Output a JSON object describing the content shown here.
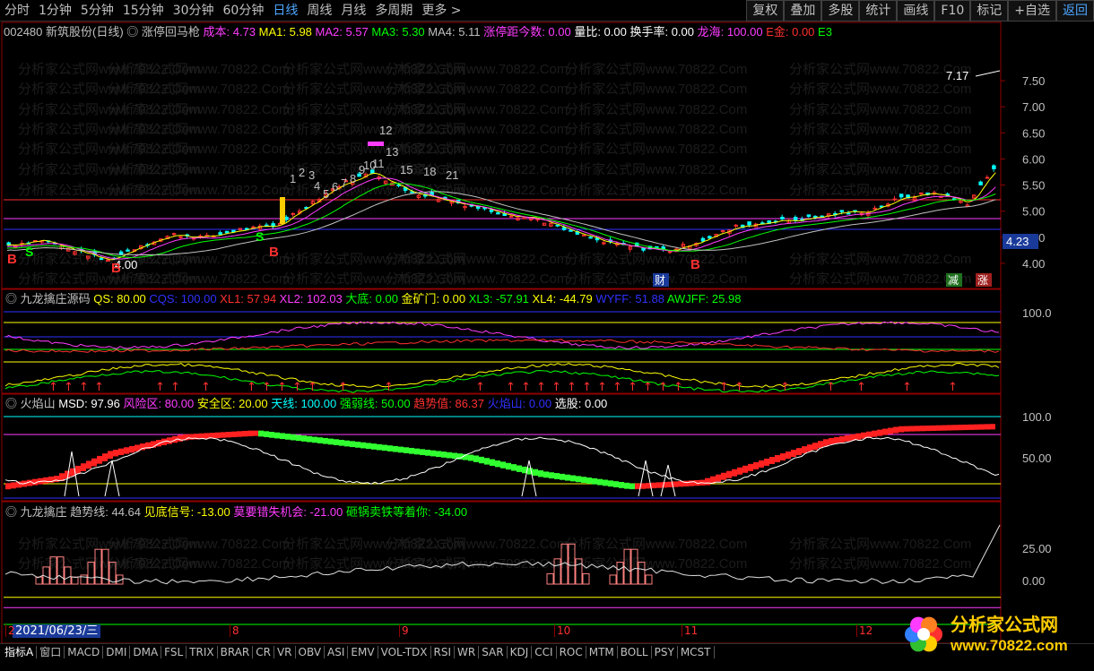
{
  "topbar": {
    "periods": [
      "分时",
      "1分钟",
      "5分钟",
      "15分钟",
      "30分钟",
      "60分钟",
      "日线",
      "周线",
      "月线",
      "多周期",
      "更多 >"
    ],
    "active": "日线",
    "tools": [
      "复权",
      "叠加",
      "多股",
      "统计",
      "画线",
      "F10",
      "标记",
      "+自选",
      "返回"
    ]
  },
  "main_panel": {
    "code": "002480",
    "name": "新筑股份(日线)",
    "formula": "涨停回马枪",
    "fields": [
      {
        "k": "成本: ",
        "v": "4.73",
        "c": "#ff3cff"
      },
      {
        "k": "MA1: ",
        "v": "5.98",
        "c": "#ffff00"
      },
      {
        "k": "MA2: ",
        "v": "5.57",
        "c": "#ff3cff"
      },
      {
        "k": "MA3: ",
        "v": "5.30",
        "c": "#00ff00"
      },
      {
        "k": "MA4: ",
        "v": "5.11",
        "c": "#c0c0c0"
      },
      {
        "k": "涨停距今数: ",
        "v": "0.00",
        "c": "#ff3cff"
      },
      {
        "k": "量比: ",
        "v": "0.00",
        "c": "#ffffff"
      },
      {
        "k": "换手率: ",
        "v": "0.00",
        "c": "#ffffff"
      },
      {
        "k": "龙海: ",
        "v": "100.00",
        "c": "#ff3cff"
      },
      {
        "k": "E金: ",
        "v": "0.00",
        "c": "#ff3030"
      },
      {
        "k": "E3",
        "v": "",
        "c": "#00ff00"
      }
    ],
    "y_ticks": [
      "7.50",
      "7.00",
      "6.50",
      "6.00",
      "5.50",
      "5.00",
      "4.50",
      "4.00"
    ],
    "price_box": "4.23",
    "high_label": "7.17",
    "low_label": "4.00",
    "b_labels": [
      "B",
      "B",
      "B",
      "B"
    ],
    "s_labels": [
      "S",
      "S"
    ],
    "counts": [
      "1",
      "2",
      "3",
      "4",
      "5",
      "6",
      "7",
      "8",
      "9",
      "10",
      "11",
      "12",
      "13",
      "15",
      "18",
      "21"
    ],
    "badges": [
      "财",
      "减",
      "涨"
    ],
    "watermark": "分析家公式网www.70822.Com"
  },
  "panel2": {
    "title": "九龙擒庄源码",
    "fields": [
      {
        "k": "QS: ",
        "v": "80.00",
        "c": "#ffff00"
      },
      {
        "k": "CQS: ",
        "v": "100.00",
        "c": "#3030ff"
      },
      {
        "k": "XL1: ",
        "v": "57.94",
        "c": "#ff3030"
      },
      {
        "k": "XL2: ",
        "v": "102.03",
        "c": "#ff3cff"
      },
      {
        "k": "大底: ",
        "v": "0.00",
        "c": "#00ff00"
      },
      {
        "k": "金矿门: ",
        "v": "0.00",
        "c": "#ffff00"
      },
      {
        "k": "XL3: ",
        "v": "-57.91",
        "c": "#00ff00"
      },
      {
        "k": "XL4: ",
        "v": "-44.79",
        "c": "#ffff00"
      },
      {
        "k": "WYFF: ",
        "v": "51.88",
        "c": "#3030ff"
      },
      {
        "k": "AWJFF: ",
        "v": "25.98",
        "c": "#00ff00"
      }
    ],
    "y_tick": "100.0"
  },
  "panel3": {
    "title": "火焰山",
    "fields": [
      {
        "k": "MSD: ",
        "v": "97.96",
        "c": "#ffffff"
      },
      {
        "k": "风险区: ",
        "v": "80.00",
        "c": "#ff3cff"
      },
      {
        "k": "安全区: ",
        "v": "20.00",
        "c": "#ffff00"
      },
      {
        "k": "天线: ",
        "v": "100.00",
        "c": "#00ffff"
      },
      {
        "k": "强弱线: ",
        "v": "50.00",
        "c": "#00ff00"
      },
      {
        "k": "趋势值: ",
        "v": "86.37",
        "c": "#ff3030"
      },
      {
        "k": "火焰山: ",
        "v": "0.00",
        "c": "#3030ff"
      },
      {
        "k": "选股: ",
        "v": "0.00",
        "c": "#ffffff"
      }
    ],
    "y_ticks": [
      "100.0",
      "50.00"
    ]
  },
  "panel4": {
    "title": "九龙擒庄",
    "fields": [
      {
        "k": "趋势线: ",
        "v": "44.64",
        "c": "#c0c0c0"
      },
      {
        "k": "见底信号: ",
        "v": "-13.00",
        "c": "#ffff00"
      },
      {
        "k": "莫要错失机会: ",
        "v": "-21.00",
        "c": "#ff3cff"
      },
      {
        "k": "砸锅卖铁等着你: ",
        "v": "-34.00",
        "c": "#00ff00"
      }
    ],
    "y_ticks": [
      "25.00",
      "0.00"
    ]
  },
  "bottom": {
    "date_cursor": "2021/06/23/三",
    "months": [
      "2",
      "8",
      "9",
      "10",
      "11",
      "12"
    ],
    "tabs": [
      "指标A",
      "窗口",
      "MACD",
      "DMI",
      "DMA",
      "FSL",
      "TRIX",
      "BRAR",
      "CR",
      "VR",
      "OBV",
      "ASI",
      "EMV",
      "VOL-TDX",
      "RSI",
      "WR",
      "SAR",
      "KDJ",
      "CCI",
      "ROC",
      "MTM",
      "BOLL",
      "PSY",
      "MCST"
    ],
    "active_tab": "指标A"
  },
  "logo": {
    "name": "分析家公式网",
    "url": "www.70822.com"
  },
  "colors": {
    "ma1": "#ffff00",
    "ma2": "#ff3cff",
    "ma3": "#00ff00",
    "ma4": "#c0c0c0",
    "up": "#ff3030",
    "down": "#00ffff",
    "bg": "#000000"
  }
}
